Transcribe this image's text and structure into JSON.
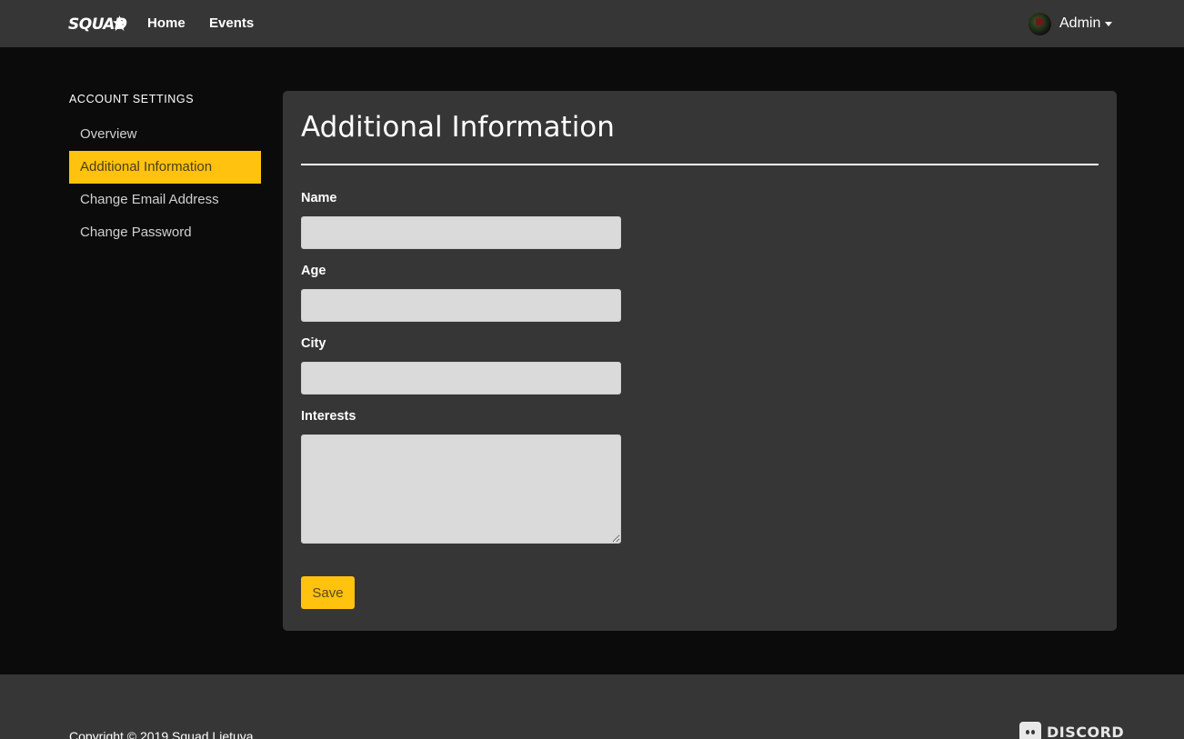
{
  "navbar": {
    "logo_text": "SQUAD",
    "links": [
      "Home",
      "Events"
    ],
    "user_name": "Admin"
  },
  "sidebar": {
    "heading": "ACCOUNT SETTINGS",
    "items": [
      {
        "label": "Overview",
        "active": false
      },
      {
        "label": "Additional Information",
        "active": true
      },
      {
        "label": "Change Email Address",
        "active": false
      },
      {
        "label": "Change Password",
        "active": false
      }
    ]
  },
  "form": {
    "title": "Additional Information",
    "fields": [
      {
        "label": "Name",
        "value": ""
      },
      {
        "label": "Age",
        "value": ""
      },
      {
        "label": "City",
        "value": ""
      },
      {
        "label": "Interests",
        "value": ""
      }
    ],
    "save_label": "Save"
  },
  "footer": {
    "copyright": "Copyright © 2019 Squad Lietuva",
    "discord_label": "DISCORD"
  },
  "colors": {
    "accent": "#ffc20e",
    "navbar_bg": "#363636",
    "page_bg": "#0b0b0b",
    "panel_bg": "#363636",
    "input_bg": "#dadada"
  }
}
